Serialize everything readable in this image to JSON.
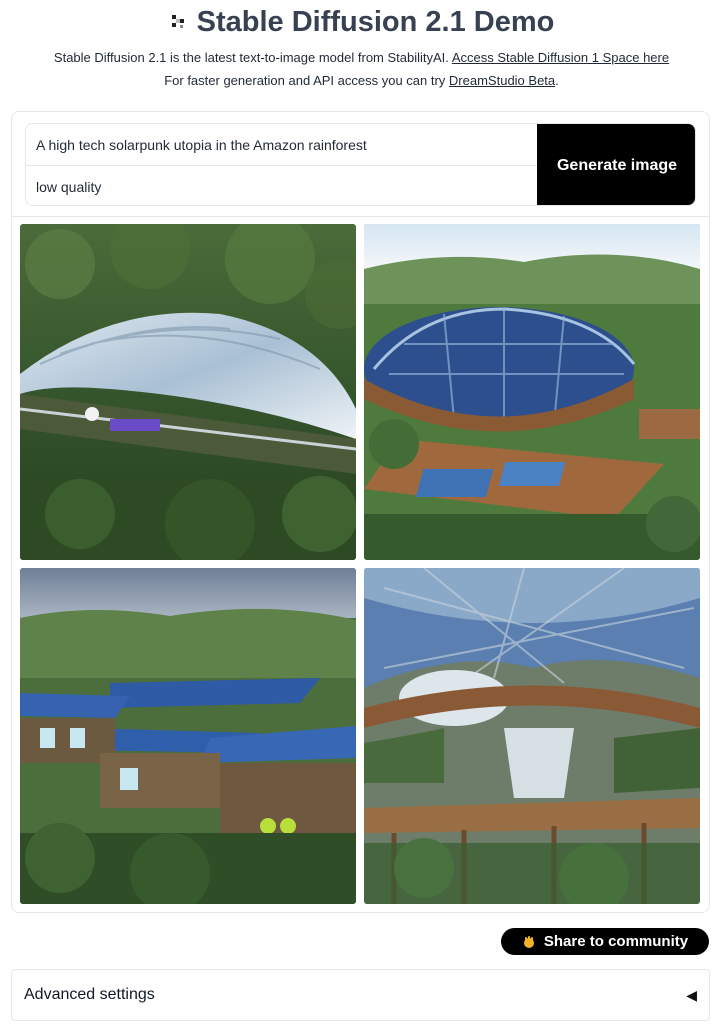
{
  "header": {
    "logo_icon": "stability-logo-icon",
    "title": "Stable Diffusion 2.1 Demo",
    "line1_text": "Stable Diffusion 2.1 is the latest text-to-image model from StabilityAI.",
    "line1_link": "Access Stable Diffusion 1 Space here",
    "line2_text": "For faster generation and API access you can try",
    "line2_link": "DreamStudio Beta",
    "line2_suffix": "."
  },
  "form": {
    "prompt_value": "A high tech solarpunk utopia in the Amazon rainforest",
    "negative_value": "low quality",
    "generate_label": "Generate image"
  },
  "gallery": {
    "images": [
      {
        "name": "generated-image-1",
        "subject": "glass-dome-in-jungle"
      },
      {
        "name": "generated-image-2",
        "subject": "solar-dome-with-deck"
      },
      {
        "name": "generated-image-3",
        "subject": "solar-roof-buildings"
      },
      {
        "name": "generated-image-4",
        "subject": "solar-canopy-treehouse"
      }
    ]
  },
  "share": {
    "label": "Share to community",
    "icon": "community-hand-icon"
  },
  "advanced": {
    "label": "Advanced settings",
    "caret": "◀"
  },
  "colors": {
    "button_bg": "#000000",
    "button_text": "#ffffff",
    "border": "#e5e7eb",
    "title": "#374151"
  }
}
